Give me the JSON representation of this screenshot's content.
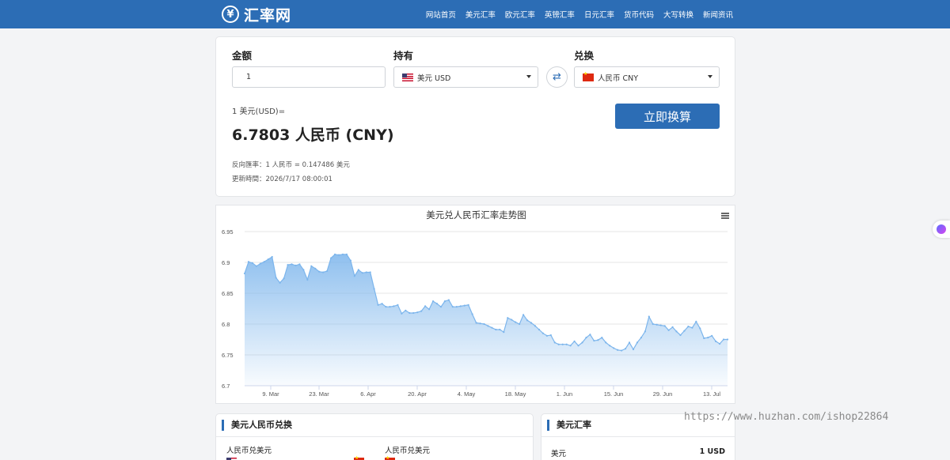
{
  "header": {
    "logo_symbol": "¥",
    "logo_text": "汇率网",
    "nav": [
      "网站首页",
      "美元汇率",
      "欧元汇率",
      "英镑汇率",
      "日元汇率",
      "货币代码",
      "大写转换",
      "新闻资讯"
    ]
  },
  "converter": {
    "amount_label": "金额",
    "amount_value": "1",
    "from_label": "持有",
    "from_currency": "美元 USD",
    "to_label": "兑换",
    "to_currency": "人民币 CNY",
    "swap_icon": "⇄",
    "result_prefix": "1 美元(USD)=",
    "result_value": "6.7803 人民币 (CNY)",
    "reverse_rate": "反向匯率：1 人民币 = 0.147486 美元",
    "updated": "更新時間：2026/7/17 08:00:01",
    "convert_button": "立即换算"
  },
  "chart_data": {
    "type": "area",
    "title": "美元兑人民币汇率走势图",
    "ylim": [
      6.7,
      6.95
    ],
    "yticks": [
      "6.95",
      "6.9",
      "6.85",
      "6.8",
      "6.75",
      "6.7"
    ],
    "xticks": [
      "9. Mar",
      "23. Mar",
      "6. Apr",
      "20. Apr",
      "4. May",
      "18. May",
      "1. Jun",
      "15. Jun",
      "29. Jun",
      "13. Jul"
    ],
    "series": [
      {
        "values": [
          6.882,
          6.901,
          6.899,
          6.894,
          6.898,
          6.901,
          6.905,
          6.909,
          6.875,
          6.867,
          6.874,
          6.896,
          6.897,
          6.895,
          6.897,
          6.888,
          6.872,
          6.894,
          6.89,
          6.885,
          6.884,
          6.886,
          6.907,
          6.913,
          6.912,
          6.913,
          6.913,
          6.903,
          6.878,
          6.888,
          6.883,
          6.884,
          6.884,
          6.857,
          6.831,
          6.833,
          6.828,
          6.828,
          6.829,
          6.831,
          6.817,
          6.822,
          6.818,
          6.818,
          6.819,
          6.821,
          6.829,
          6.824,
          6.837,
          6.833,
          6.828,
          6.837,
          6.839,
          6.828,
          6.828,
          6.829,
          6.83,
          6.831,
          6.816,
          6.802,
          6.801,
          6.8,
          6.797,
          6.794,
          6.791,
          6.791,
          6.787,
          6.81,
          6.807,
          6.803,
          6.8,
          6.815,
          6.806,
          6.802,
          6.797,
          6.791,
          6.785,
          6.781,
          6.782,
          6.77,
          6.767,
          6.767,
          6.767,
          6.765,
          6.772,
          6.765,
          6.77,
          6.778,
          6.783,
          6.773,
          6.774,
          6.778,
          6.77,
          6.765,
          6.761,
          6.758,
          6.757,
          6.76,
          6.77,
          6.759,
          6.77,
          6.778,
          6.788,
          6.812,
          6.8,
          6.799,
          6.798,
          6.797,
          6.79,
          6.795,
          6.788,
          6.782,
          6.789,
          6.796,
          6.794,
          6.804,
          6.793,
          6.777,
          6.778,
          6.781,
          6.772,
          6.768,
          6.775,
          6.775
        ]
      }
    ]
  },
  "lower_left": {
    "title": "美元人民币兑换",
    "col1": "人民币兑美元",
    "col2": "人民币兑美元"
  },
  "lower_right": {
    "title": "美元汇率",
    "row_label": "美元",
    "row_value": "1 USD"
  },
  "watermark": "https://www.huzhan.com/ishop22864"
}
